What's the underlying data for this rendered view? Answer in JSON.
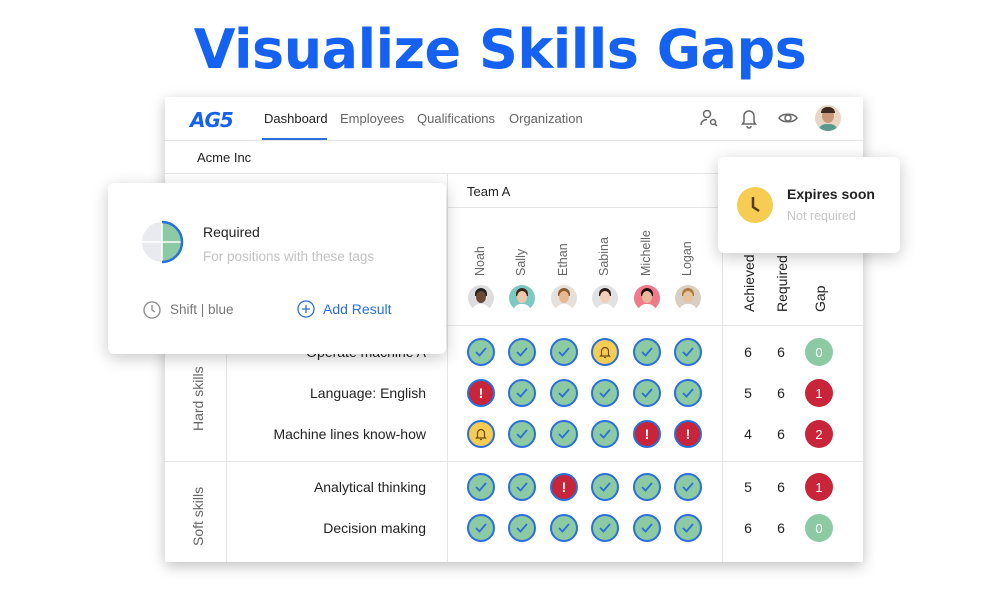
{
  "headline": "Visualize Skills Gaps",
  "nav": {
    "logo": "AG5",
    "tabs": [
      {
        "label": "Dashboard",
        "active": true
      },
      {
        "label": "Employees"
      },
      {
        "label": "Qualifications"
      },
      {
        "label": "Organization"
      }
    ],
    "icons": [
      "user-search-icon",
      "bell-icon",
      "eye-icon",
      "avatar"
    ]
  },
  "company": "Acme Inc",
  "team": "Team A",
  "employees": [
    "Noah",
    "Sally",
    "Ethan",
    "Sabina",
    "Michelle",
    "Logan"
  ],
  "summary_headers": [
    "Achieved",
    "Required",
    "Gap"
  ],
  "groups": [
    {
      "label": "Hard skills"
    },
    {
      "label": "Soft skills"
    }
  ],
  "skills": [
    {
      "label": "Operate machine A",
      "group": "Hard skills",
      "status": [
        "ok",
        "ok",
        "ok",
        "warn",
        "ok",
        "ok"
      ],
      "achieved": "6",
      "required": "6",
      "gap": "0"
    },
    {
      "label": "Language: English",
      "group": "Hard skills",
      "status": [
        "alert",
        "ok",
        "ok",
        "ok",
        "ok",
        "ok"
      ],
      "achieved": "5",
      "required": "6",
      "gap": "1"
    },
    {
      "label": "Machine lines know-how",
      "group": "Hard skills",
      "status": [
        "warn",
        "ok",
        "ok",
        "ok",
        "alert",
        "alert"
      ],
      "achieved": "4",
      "required": "6",
      "gap": "2"
    },
    {
      "label": "Analytical thinking",
      "group": "Soft skills",
      "status": [
        "ok",
        "ok",
        "alert",
        "ok",
        "ok",
        "ok"
      ],
      "achieved": "5",
      "required": "6",
      "gap": "1"
    },
    {
      "label": "Decision making",
      "group": "Soft skills",
      "status": [
        "ok",
        "ok",
        "ok",
        "ok",
        "ok",
        "ok"
      ],
      "achieved": "6",
      "required": "6",
      "gap": "0"
    }
  ],
  "popup_required": {
    "title": "Required",
    "subtitle": "For positions with these tags",
    "shift": "Shift | blue",
    "add": "Add Result"
  },
  "popup_expires": {
    "title": "Expires soon",
    "subtitle": "Not required"
  },
  "colors": {
    "brand": "#1562f2",
    "ok": "#8ccaa4",
    "alert": "#c8243a",
    "warn": "#f6cd52",
    "ring": "#2a6fdb"
  }
}
